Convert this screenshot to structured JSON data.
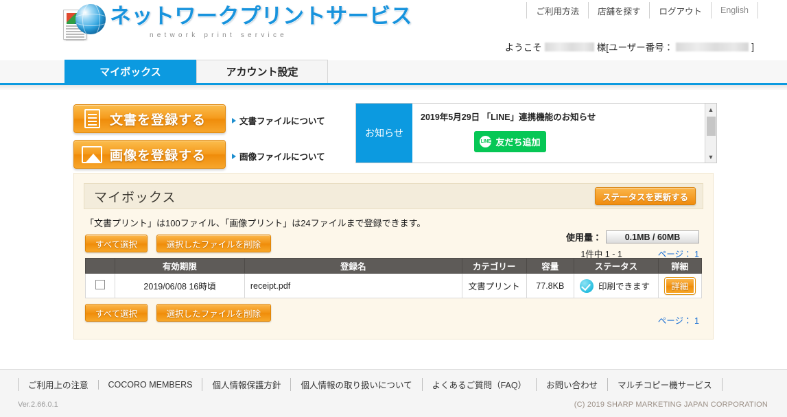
{
  "header": {
    "logo": {
      "title": "ネットワークプリントサービス",
      "subtitle": "network print service"
    },
    "topnav": [
      {
        "label": "ご利用方法"
      },
      {
        "label": "店舗を探す"
      },
      {
        "label": "ログアウト"
      },
      {
        "label": "English"
      }
    ],
    "welcome": {
      "greeting": "ようこそ",
      "suffix_before": "様[ユーザー番号：",
      "suffix_after": "]"
    }
  },
  "tabs": [
    {
      "label": "マイボックス",
      "active": true
    },
    {
      "label": "アカウント設定",
      "active": false
    }
  ],
  "register": {
    "document_button": "文書を登録する",
    "image_button": "画像を登録する",
    "document_link": "文書ファイルについて",
    "image_link": "画像ファイルについて"
  },
  "notice": {
    "label": "お知らせ",
    "text": "2019年5月29日 「LINE」連携機能のお知らせ",
    "line_button": "友だち追加",
    "line_badge": "LINE"
  },
  "mybox": {
    "title": "マイボックス",
    "refresh_button": "ステータスを更新する",
    "limit_note": "「文書プリント」は100ファイル、「画像プリント」は24ファイルまで登録できます。",
    "select_all_button": "すべて選択",
    "delete_selected_button": "選択したファイルを削除",
    "usage_label": "使用量：",
    "usage_value": "0.1MB / 60MB",
    "count_text": "1件中 1 - 1",
    "page_label": "ページ：",
    "page_number": "1",
    "columns": [
      "",
      "有効期限",
      "登録名",
      "カテゴリー",
      "容量",
      "ステータス",
      "詳細"
    ],
    "rows": [
      {
        "expiry": "2019/06/08 16時頃",
        "name": "receipt.pdf",
        "category": "文書プリント",
        "size": "77.8KB",
        "status": "印刷できます",
        "detail_button": "詳細"
      }
    ]
  },
  "footer": {
    "links": [
      {
        "label": "ご利用上の注意"
      },
      {
        "label": "COCORO MEMBERS"
      },
      {
        "label": "個人情報保護方針"
      },
      {
        "label": "個人情報の取り扱いについて"
      },
      {
        "label": "よくあるご質問（FAQ）"
      },
      {
        "label": "お問い合わせ"
      },
      {
        "label": "マルチコピー機サービス"
      }
    ],
    "version": "Ver.2.66.0.1",
    "copyright": "(C) 2019 SHARP MARKETING JAPAN CORPORATION"
  },
  "colors": {
    "accent_blue": "#0c9ae0",
    "accent_orange": "#f29312",
    "panel_cream": "#fdf7ea",
    "table_header": "#5e5b58",
    "line_green": "#06c755",
    "status_cyan": "#29bfe0"
  }
}
